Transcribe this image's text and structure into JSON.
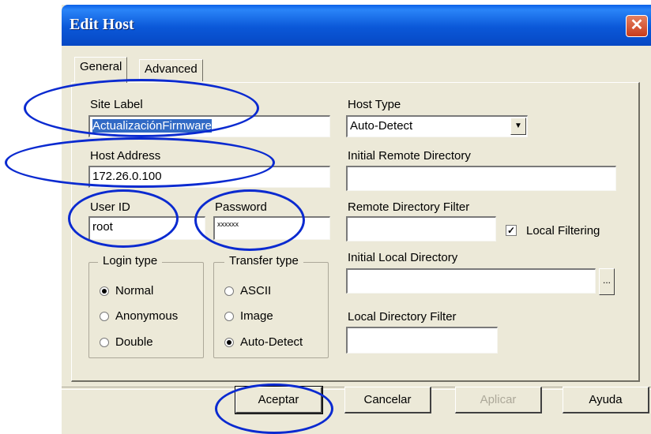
{
  "window": {
    "title": "Edit Host",
    "close_glyph": "✕"
  },
  "tabs": [
    {
      "label": "General"
    },
    {
      "label": "Advanced"
    }
  ],
  "general": {
    "site_label": {
      "label": "Site Label",
      "value": "ActualizaciónFirmware"
    },
    "host_address": {
      "label": "Host Address",
      "value": "172.26.0.100"
    },
    "user_id": {
      "label": "User ID",
      "value": "root"
    },
    "password": {
      "label": "Password",
      "value": "xxxxxx"
    },
    "login_type": {
      "legend": "Login type",
      "options": [
        "Normal",
        "Anonymous",
        "Double"
      ],
      "selected": "Normal"
    },
    "transfer_type": {
      "legend": "Transfer type",
      "options": [
        "ASCII",
        "Image",
        "Auto-Detect"
      ],
      "selected": "Auto-Detect"
    },
    "host_type": {
      "label": "Host Type",
      "value": "Auto-Detect"
    },
    "initial_remote_directory": {
      "label": "Initial Remote Directory",
      "value": ""
    },
    "remote_directory_filter": {
      "label": "Remote Directory Filter",
      "value": ""
    },
    "local_filtering": {
      "label": "Local Filtering",
      "checked": true
    },
    "initial_local_directory": {
      "label": "Initial Local Directory",
      "value": "",
      "browse_label": "..."
    },
    "local_directory_filter": {
      "label": "Local Directory Filter",
      "value": ""
    }
  },
  "buttons": {
    "ok": "Aceptar",
    "cancel": "Cancelar",
    "apply": "Aplicar",
    "help": "Ayuda"
  },
  "annotation_color": "#0a2ad0"
}
